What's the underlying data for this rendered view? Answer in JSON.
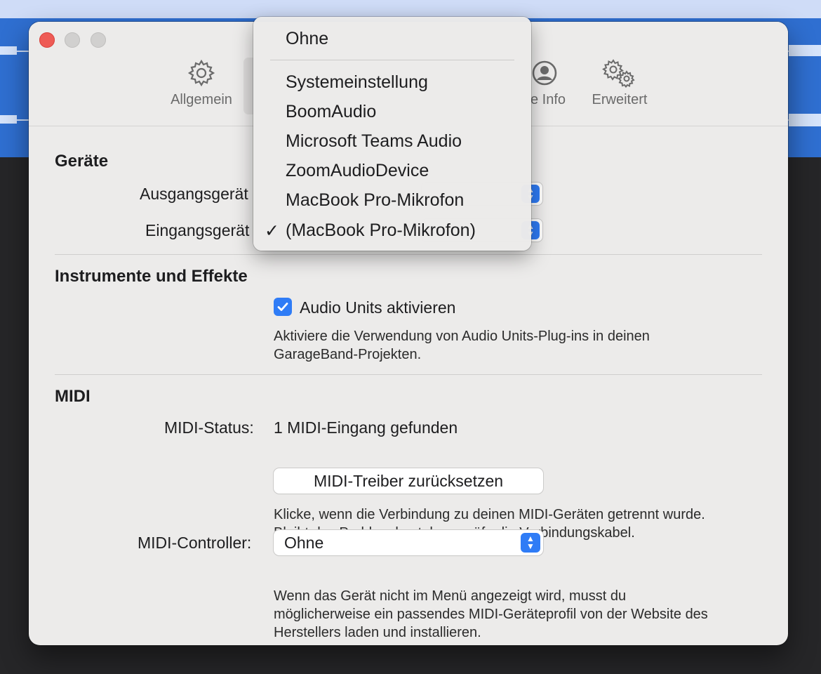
{
  "tabs": {
    "general": "Allgemein",
    "my_info": "e Info",
    "advanced": "Erweitert"
  },
  "sections": {
    "devices": {
      "title": "Geräte",
      "output_label": "Ausgangsgerät",
      "input_label": "Eingangsgerät"
    },
    "instruments": {
      "title": "Instrumente und Effekte",
      "au_checkbox_label": "Audio Units aktivieren",
      "au_checked": true,
      "au_desc_line1": "Aktiviere die Verwendung von Audio Units-Plug-ins in deinen",
      "au_desc_line2": "GarageBand-Projekten."
    },
    "midi": {
      "title": "MIDI",
      "status_label": "MIDI-Status:",
      "status_value": "1 MIDI-Eingang gefunden",
      "reset_button": "MIDI-Treiber zurücksetzen",
      "reset_desc_line1": "Klicke, wenn die Verbindung zu deinen MIDI-Geräten getrennt wurde.",
      "reset_desc_line2": "Bleibt das Problem bestehen, prüfe die Verbindungskabel.",
      "controller_label": "MIDI-Controller:",
      "controller_value": "Ohne",
      "controller_desc_line1": "Wenn das Gerät nicht im Menü angezeigt wird, musst du",
      "controller_desc_line2": "möglicherweise ein passendes MIDI-Geräteprofil von der Website des",
      "controller_desc_line3": "Herstellers laden und installieren."
    }
  },
  "input_menu": {
    "none": "Ohne",
    "items": [
      "Systemeinstellung",
      "BoomAudio",
      "Microsoft Teams Audio",
      "ZoomAudioDevice",
      "MacBook Pro-Mikrofon",
      "(MacBook Pro-Mikrofon)"
    ],
    "selected_index": 5,
    "check_mark": "✓"
  },
  "colors": {
    "accent": "#2f7cf6",
    "close": "#ee5b55",
    "window_bg": "#ecebea"
  }
}
